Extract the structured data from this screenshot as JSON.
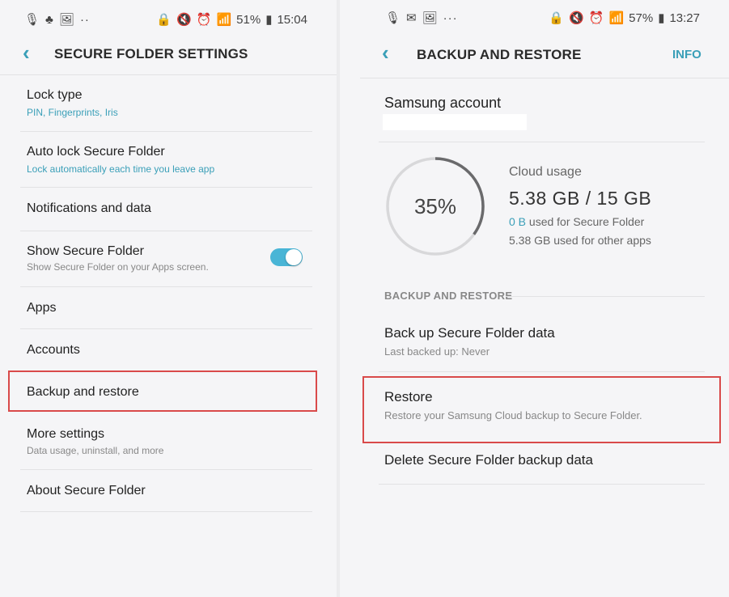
{
  "left": {
    "status": {
      "left_icons": [
        "🎙",
        "♣",
        "🖼",
        "··"
      ],
      "right_icons": [
        "🔒",
        "🔇",
        "⏰",
        "📶"
      ],
      "battery": "51%",
      "time": "15:04"
    },
    "title": "SECURE FOLDER SETTINGS",
    "items": [
      {
        "title": "Lock type",
        "subtitle": "PIN, Fingerprints, Iris"
      },
      {
        "title": "Auto lock Secure Folder",
        "subtitle": "Lock automatically each time you leave app"
      },
      {
        "title": "Notifications and data"
      },
      {
        "title": "Show Secure Folder",
        "subtitle": "Show Secure Folder on your Apps screen.",
        "toggle": true
      },
      {
        "title": "Apps"
      },
      {
        "title": "Accounts"
      },
      {
        "title": "Backup and restore"
      },
      {
        "title": "More settings",
        "subtitle": "Data usage, uninstall, and more"
      },
      {
        "title": "About Secure Folder"
      }
    ]
  },
  "right": {
    "status": {
      "left_icons": [
        "🎙",
        "✉",
        "🖼",
        "···"
      ],
      "right_icons": [
        "🔒",
        "🔇",
        "⏰",
        "📶"
      ],
      "battery": "57%",
      "time": "13:27"
    },
    "title": "BACKUP AND RESTORE",
    "info": "INFO",
    "account_title": "Samsung account",
    "cloud": {
      "percent_label": "35%",
      "percent": 35,
      "label": "Cloud usage",
      "value": "5.38 GB / 15 GB",
      "line1_accent": "0 B",
      "line1_rest": " used for Secure Folder",
      "line2": "5.38 GB used for other apps"
    },
    "section_header": "BACKUP AND RESTORE",
    "items": [
      {
        "title": "Back up Secure Folder data",
        "subtitle": "Last backed up: Never"
      },
      {
        "title": "Restore",
        "subtitle": "Restore your Samsung Cloud backup to Secure Folder."
      },
      {
        "title": "Delete Secure Folder backup data"
      }
    ]
  }
}
